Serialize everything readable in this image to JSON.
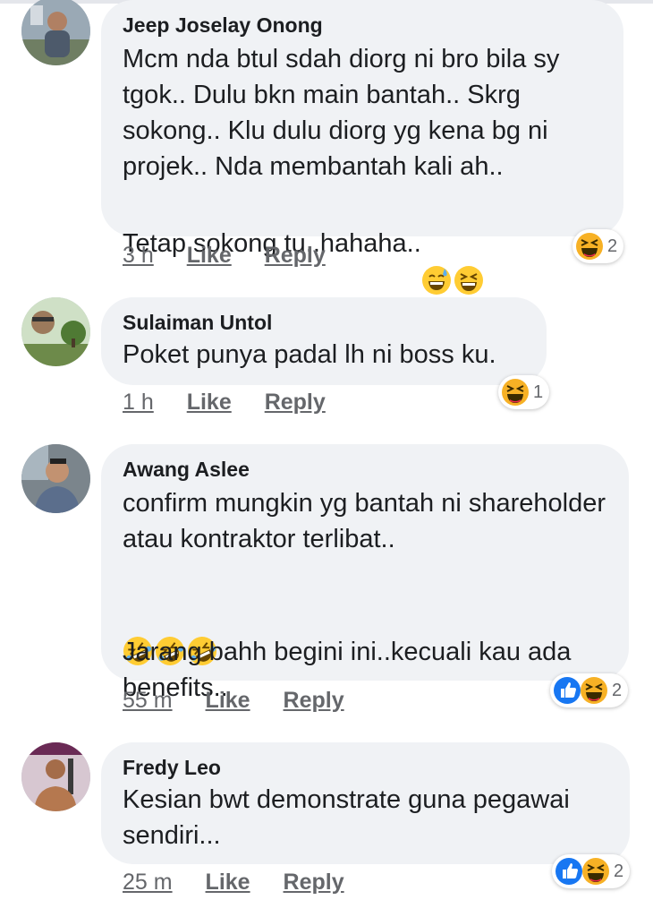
{
  "comments": [
    {
      "author": "Jeep Joselay Onong",
      "text": "Mcm nda btul sdah diorg ni bro bila sy tgok.. Dulu bkn main bantah.. Skrg sokong.. Klu dulu diorg yg kena bg ni projek.. Nda membantah kali ah..",
      "text2": "Tetap sokong tu..hahaha..",
      "time": "3 h",
      "like": "Like",
      "reply": "Reply",
      "reaction_count": "2",
      "reaction_icons": [
        "haha-icon"
      ]
    },
    {
      "author": "Sulaiman Untol",
      "text": "Poket punya padal lh ni boss ku.",
      "time": "1 h",
      "like": "Like",
      "reply": "Reply",
      "reaction_count": "1",
      "reaction_icons": [
        "haha-icon"
      ]
    },
    {
      "author": "Awang Aslee",
      "text": "confirm mungkin yg bantah ni shareholder atau kontraktor terlibat..",
      "text2": "Jarang bahh begini ini..kecuali kau ada benefits..",
      "time": "55 m",
      "like": "Like",
      "reply": "Reply",
      "reaction_count": "2",
      "reaction_icons": [
        "like-icon",
        "haha-icon"
      ]
    },
    {
      "author": "Fredy Leo",
      "text": "Kesian bwt demonstrate guna pegawai sendiri...",
      "time": "25 m",
      "like": "Like",
      "reply": "Reply",
      "reaction_count": "2",
      "reaction_icons": [
        "like-icon",
        "haha-icon"
      ]
    }
  ],
  "colors": {
    "bubble": "#f0f2f5",
    "meta_text": "#65676b",
    "like_blue": "#1877f2",
    "haha_yellow": "#f7b125"
  }
}
